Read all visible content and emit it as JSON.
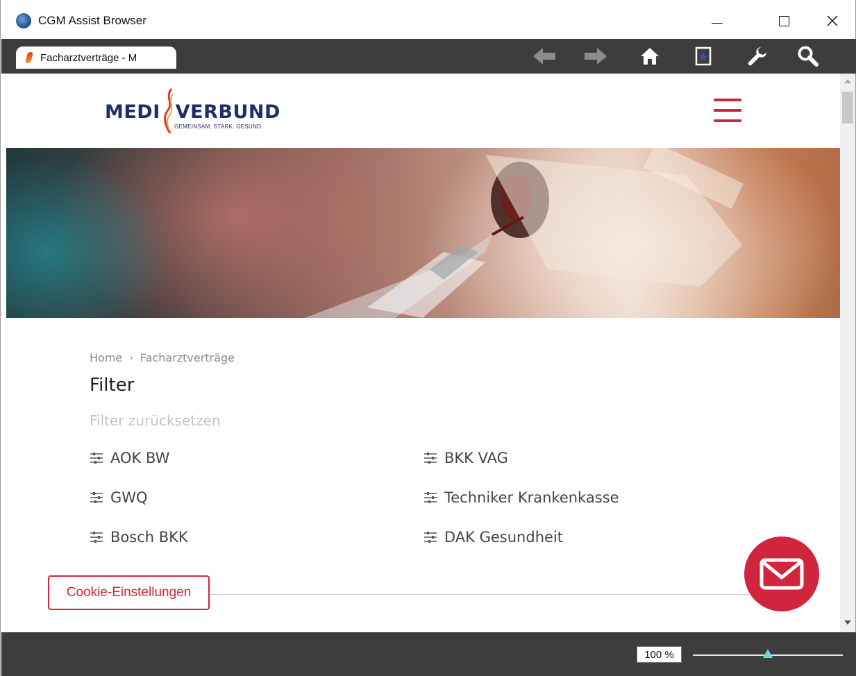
{
  "window": {
    "title": "CGM Assist Browser",
    "logo_icon": "cgm-globe-icon",
    "controls": [
      "minimize-icon",
      "maximize-icon",
      "close-icon"
    ]
  },
  "browser": {
    "tab_label": "Facharztverträge - M",
    "toolbar_icons": [
      "back-arrow-icon",
      "forward-arrow-icon",
      "home-icon",
      "bookmark-icon",
      "wrench-icon",
      "search-icon"
    ]
  },
  "site": {
    "brand": {
      "left": "MEDI",
      "right": "VERBUND",
      "tagline": "GEMEINSAM. STARK. GESUND."
    },
    "accent_color": "#d0263d",
    "brand_color": "#1c2f6b"
  },
  "breadcrumb": {
    "home": "Home",
    "separator": "›",
    "current": "Facharztverträge"
  },
  "filter": {
    "title": "Filter",
    "reset": "Filter zurücksetzen",
    "items": [
      {
        "label": "AOK BW"
      },
      {
        "label": "BKK VAG"
      },
      {
        "label": "GWQ"
      },
      {
        "label": "Techniker Krankenkasse"
      },
      {
        "label": "Bosch BKK"
      },
      {
        "label": "DAK Gesundheit"
      }
    ]
  },
  "cookie_button": "Cookie-Einstellungen",
  "contact_icon": "mail-icon",
  "status": {
    "zoom": "100 %",
    "zoom_level": 0.5
  }
}
